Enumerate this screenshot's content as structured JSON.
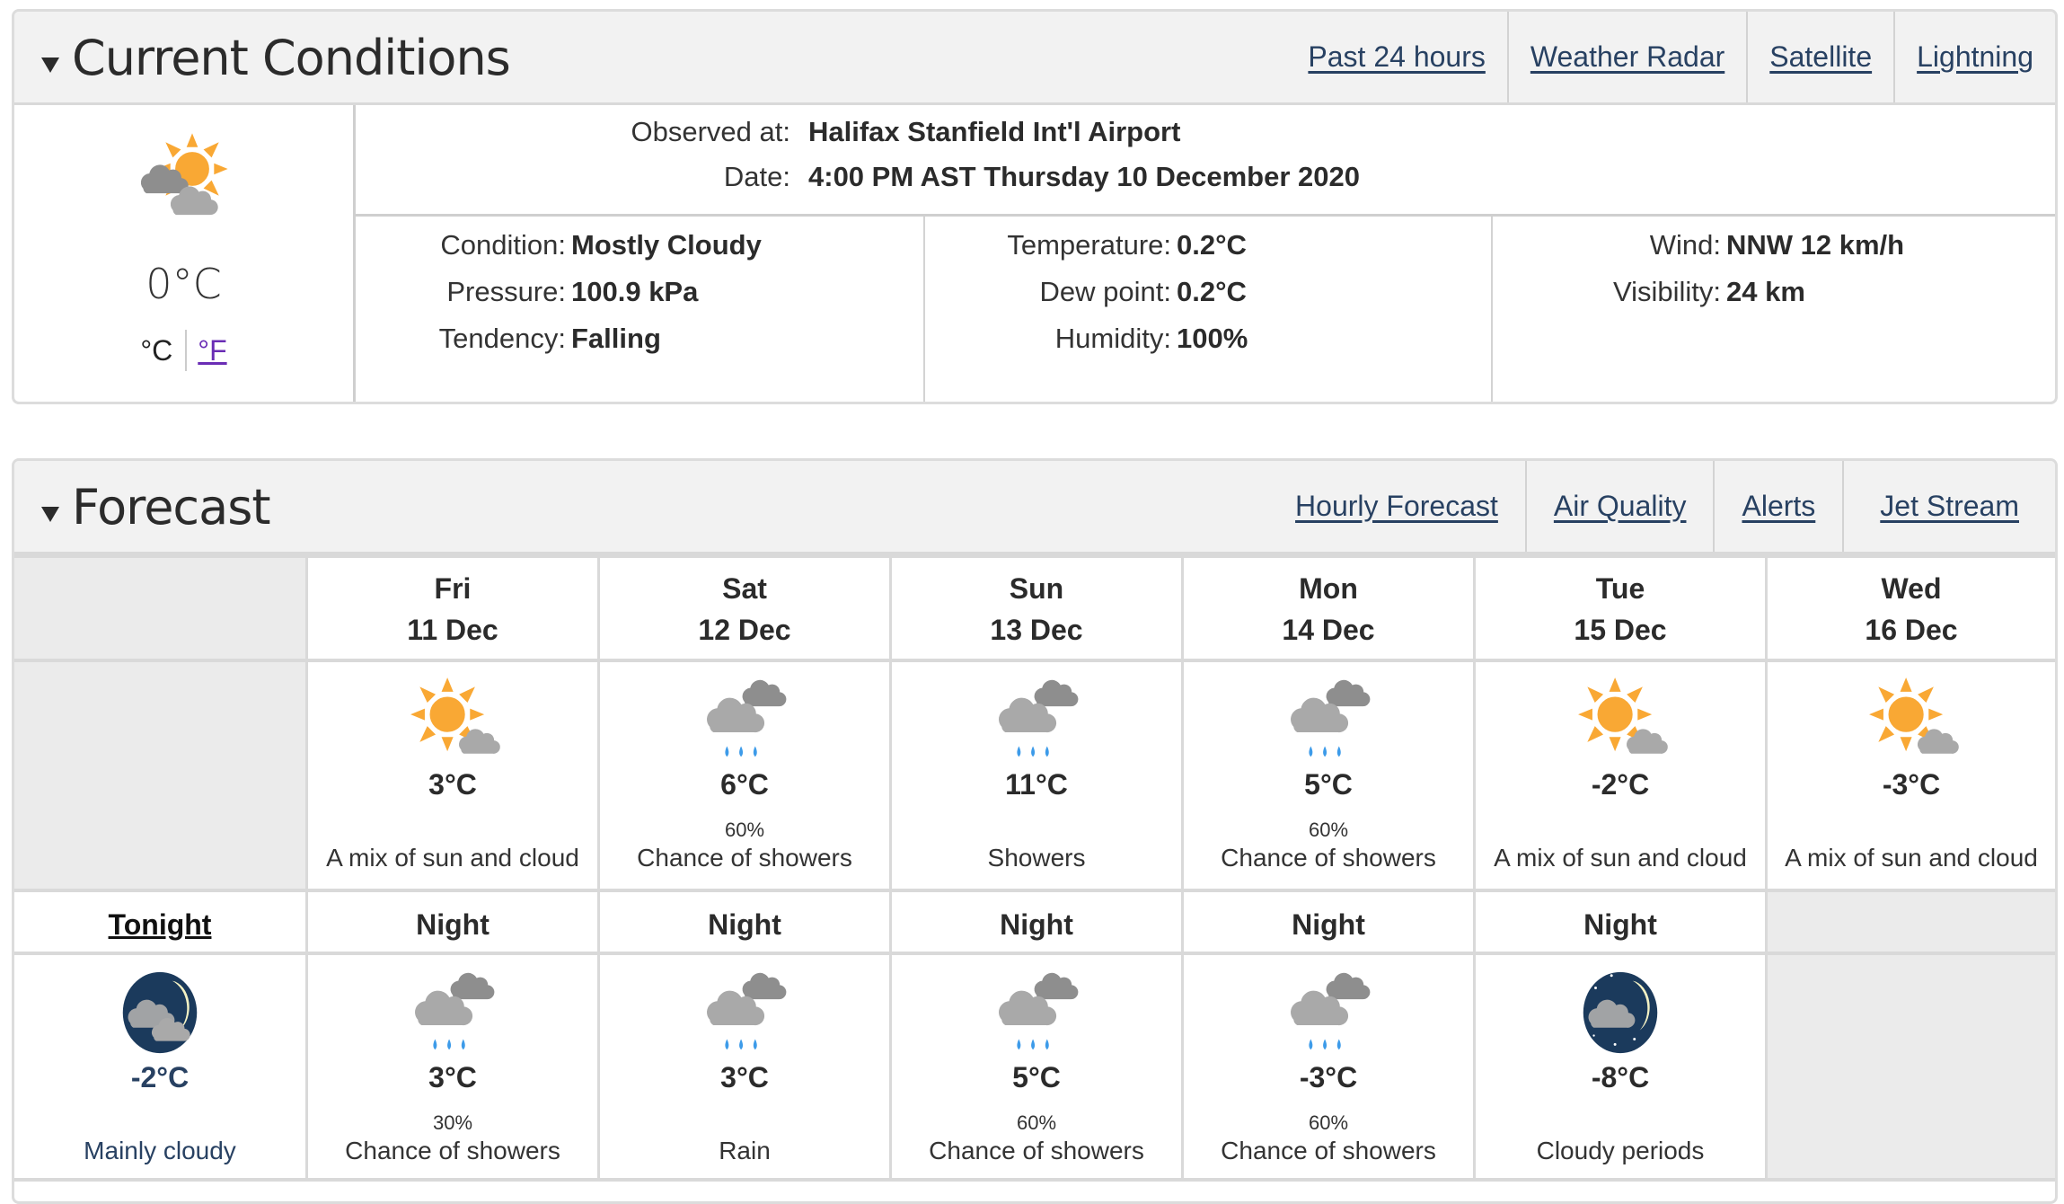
{
  "current": {
    "title": "Current Conditions",
    "links": [
      "Past 24 hours",
      "Weather Radar",
      "Satellite",
      "Lightning"
    ],
    "icon": "sun-with-clouds-icon",
    "temperature": "0°C",
    "unit_c": "°C",
    "unit_f": "°F",
    "observed_label": "Observed at:",
    "observed_value": "Halifax Stanfield Int'l Airport",
    "date_label": "Date:",
    "date_value": "4:00 PM AST Thursday 10 December 2020",
    "columns": [
      [
        {
          "label": "Condition:",
          "value": "Mostly Cloudy"
        },
        {
          "label": "Pressure:",
          "value": "100.9 kPa"
        },
        {
          "label": "Tendency:",
          "value": "Falling"
        }
      ],
      [
        {
          "label": "Temperature:",
          "value": "0.2°C"
        },
        {
          "label": "Dew point:",
          "value": "0.2°C"
        },
        {
          "label": "Humidity:",
          "value": "100%"
        }
      ],
      [
        {
          "label": "Wind:",
          "value": "NNW 12 km/h"
        },
        {
          "label": "Visibility:",
          "value": "24 km"
        }
      ]
    ]
  },
  "forecast": {
    "title": "Forecast",
    "links": [
      "Hourly Forecast",
      "Air Quality",
      "Alerts",
      "Jet Stream"
    ],
    "days": [
      {
        "name": "Fri",
        "date": "11 Dec",
        "icon": "sun-cloud-icon",
        "temp": "3°C",
        "pop": "",
        "summary": "A mix of sun and cloud"
      },
      {
        "name": "Sat",
        "date": "12 Dec",
        "icon": "rain-cloud-icon",
        "temp": "6°C",
        "pop": "60%",
        "summary": "Chance of showers"
      },
      {
        "name": "Sun",
        "date": "13 Dec",
        "icon": "rain-cloud-icon",
        "temp": "11°C",
        "pop": "",
        "summary": "Showers"
      },
      {
        "name": "Mon",
        "date": "14 Dec",
        "icon": "rain-cloud-icon",
        "temp": "5°C",
        "pop": "60%",
        "summary": "Chance of showers"
      },
      {
        "name": "Tue",
        "date": "15 Dec",
        "icon": "sun-cloud-icon",
        "temp": "-2°C",
        "pop": "",
        "summary": "A mix of sun and cloud"
      },
      {
        "name": "Wed",
        "date": "16 Dec",
        "icon": "sun-cloud-icon",
        "temp": "-3°C",
        "pop": "",
        "summary": "A mix of sun and cloud"
      }
    ],
    "nights": [
      {
        "label": "Tonight",
        "icon": "moon-clouds-icon",
        "temp": "-2°C",
        "pop": "",
        "summary": "Mainly cloudy"
      },
      {
        "label": "Night",
        "icon": "rain-cloud-icon",
        "temp": "3°C",
        "pop": "30%",
        "summary": "Chance of showers"
      },
      {
        "label": "Night",
        "icon": "rain-cloud-icon",
        "temp": "3°C",
        "pop": "",
        "summary": "Rain"
      },
      {
        "label": "Night",
        "icon": "rain-cloud-icon",
        "temp": "5°C",
        "pop": "60%",
        "summary": "Chance of showers"
      },
      {
        "label": "Night",
        "icon": "rain-cloud-icon",
        "temp": "-3°C",
        "pop": "60%",
        "summary": "Chance of showers"
      },
      {
        "label": "Night",
        "icon": "moon-cloud-stars-icon",
        "temp": "-8°C",
        "pop": "",
        "summary": "Cloudy periods"
      }
    ]
  },
  "colors": {
    "link": "#284162",
    "visited_link": "#6a2db5",
    "sun": "#f9a834",
    "rain": "#3d9be9",
    "night_sky": "#1b3a5c",
    "header_bg": "#f2f2f2"
  }
}
